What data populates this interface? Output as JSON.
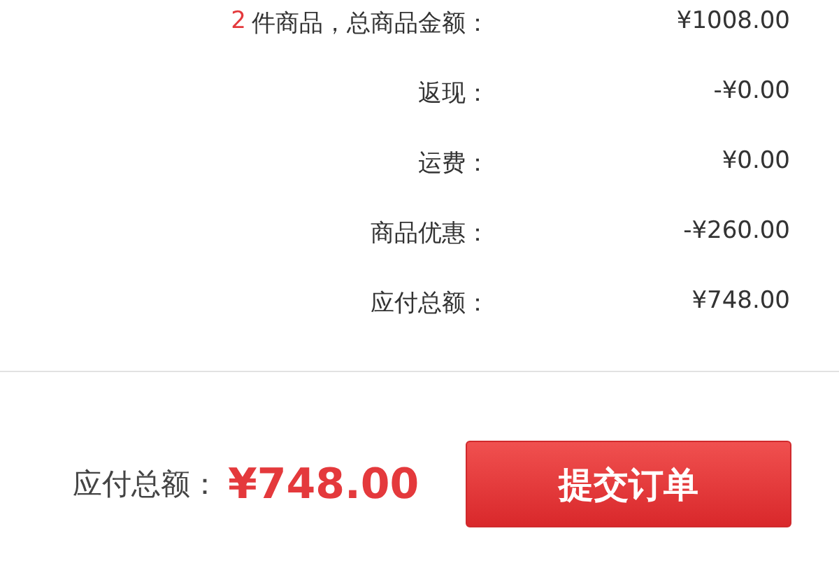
{
  "summary": {
    "rows": [
      {
        "count": "2",
        "label": "件商品，总商品金额：",
        "value": "¥1008.00"
      },
      {
        "label": "返现：",
        "value": "-¥0.00"
      },
      {
        "label": "运费：",
        "value": "¥0.00"
      },
      {
        "label": "商品优惠：",
        "value": "-¥260.00"
      },
      {
        "label": "应付总额：",
        "value": "¥748.00"
      }
    ]
  },
  "checkout": {
    "label": "应付总额：",
    "amount": "¥748.00",
    "submit_button": "提交订单"
  }
}
